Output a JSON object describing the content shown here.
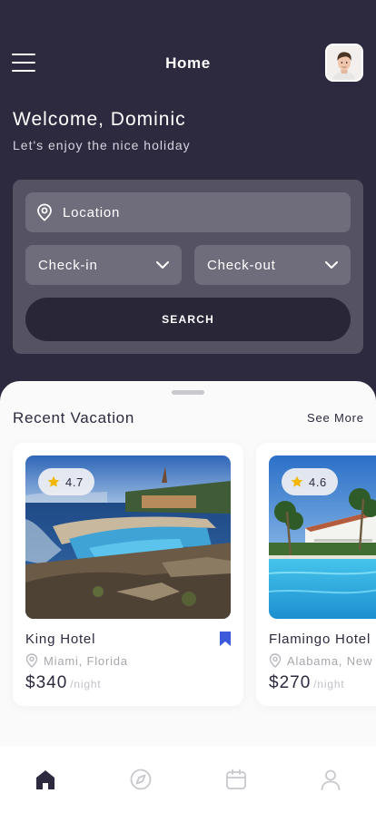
{
  "header": {
    "title": "Home",
    "welcome": "Welcome, Dominic",
    "subtitle": "Let's enjoy the nice holiday"
  },
  "search": {
    "location_placeholder": "Location",
    "checkin_label": "Check-in",
    "checkout_label": "Check-out",
    "button_label": "SEARCH"
  },
  "recent": {
    "title": "Recent Vacation",
    "see_more": "See More",
    "cards": [
      {
        "name": "King Hotel",
        "location": "Miami, Florida",
        "rating": "4.7",
        "price": "$340",
        "per": "/night",
        "bookmarked": true
      },
      {
        "name": "Flamingo Hotel",
        "location": "Alabama, New",
        "rating": "4.6",
        "price": "$270",
        "per": "/night",
        "bookmarked": false
      }
    ]
  },
  "tabbar": {
    "items": [
      "home-icon",
      "compass-icon",
      "calendar-icon",
      "profile-icon"
    ],
    "active": "home-icon"
  },
  "colors": {
    "primary": "#2d2a3f",
    "search_card": "#545263",
    "field": "#6f6d7c",
    "accent_blue": "#3b5bdb",
    "star": "#f2b705"
  }
}
